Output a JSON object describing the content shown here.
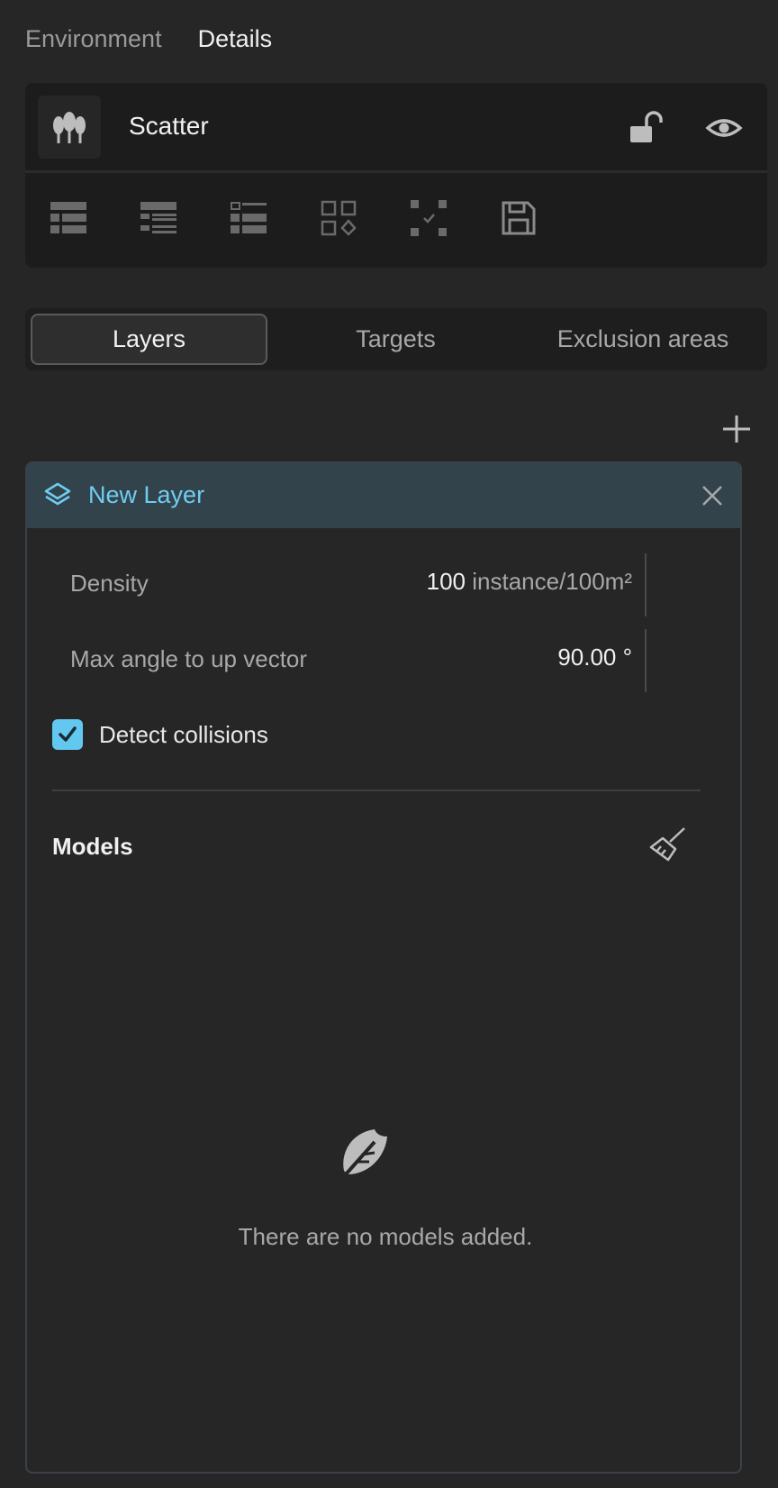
{
  "top_tabs": {
    "environment": "Environment",
    "details": "Details"
  },
  "scatter": {
    "title": "Scatter",
    "icon": "scatter-trees-icon",
    "lock_icon": "unlock-icon",
    "visibility_icon": "eye-icon",
    "toolbar_icons": [
      "list-icon",
      "list-indented-icon",
      "list-outline-icon",
      "grid-shapes-icon",
      "select-corners-icon",
      "save-icon"
    ]
  },
  "section_tabs": {
    "layers": "Layers",
    "targets": "Targets",
    "exclusion_areas": "Exclusion areas"
  },
  "layer": {
    "title": "New Layer",
    "icon": "layers-icon",
    "density_label": "Density",
    "density_value": "100",
    "density_unit": "instance/100m²",
    "max_angle_label": "Max angle to up vector",
    "max_angle_value": "90.00 °",
    "detect_collisions_label": "Detect collisions",
    "detect_collisions_checked": true,
    "models_title": "Models",
    "empty_text": "There are no models added."
  },
  "colors": {
    "accent": "#62c8f0",
    "layer_header": "#33434b",
    "background": "#262626"
  }
}
